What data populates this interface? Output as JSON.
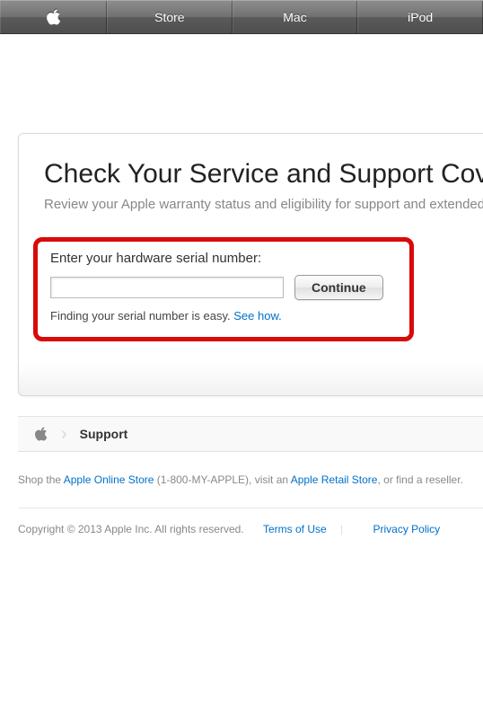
{
  "nav": {
    "store": "Store",
    "mac": "Mac",
    "ipod": "iPod"
  },
  "card": {
    "title": "Check Your Service and Support Coverage",
    "subtitle": "Review your Apple warranty status and eligibility for support and extended coverage."
  },
  "form": {
    "label": "Enter your hardware serial number:",
    "input_value": "",
    "continue": "Continue",
    "help_text": "Finding your serial number is easy. ",
    "help_link": "See how."
  },
  "breadcrumb": {
    "support": "Support"
  },
  "footer": {
    "shop_prefix": "Shop the ",
    "store_link": "Apple Online Store",
    "phone": " (1-800-MY-APPLE), visit an ",
    "retail_link": "Apple Retail Store",
    "suffix": ", or find a reseller.",
    "copyright": "Copyright © 2013 Apple Inc. All rights reserved.",
    "terms": "Terms of Use",
    "privacy": "Privacy Policy"
  }
}
